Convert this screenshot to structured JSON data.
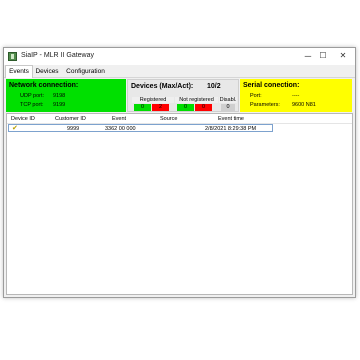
{
  "window": {
    "title": "SiaIP - MLR II Gateway",
    "controls": {
      "minimize": "─",
      "maximize": "☐",
      "close": "✕"
    }
  },
  "tabs": [
    {
      "label": "Events",
      "active": true
    },
    {
      "label": "Devices",
      "active": false
    },
    {
      "label": "Configuration",
      "active": false
    }
  ],
  "network": {
    "title": "Network connection:",
    "udp_label": "UDP port:",
    "udp_value": "9198",
    "tcp_label": "TCP port:",
    "tcp_value": "9199",
    "color": "#00e000"
  },
  "devices": {
    "title": "Devices (Max/Act):",
    "value": "10/2",
    "registered_label": "Registered",
    "not_registered_label": "Not registered",
    "disabled_label": "Disabl.",
    "registered_ok": "0",
    "registered_bad": "2",
    "not_registered_ok": "0",
    "not_registered_bad": "0",
    "disabled": "0"
  },
  "serial": {
    "title": "Serial conection:",
    "port_label": "Port:",
    "port_value": "----",
    "params_label": "Parameters:",
    "params_value": "9600 N81",
    "color": "#ffff00"
  },
  "events_table": {
    "columns": [
      "Device ID",
      "Customer ID",
      "Event",
      "Source",
      "Event time"
    ],
    "rows": [
      {
        "device_id": "",
        "customer_id": "9999",
        "event": "3362 00 000",
        "source": "",
        "event_time": "2/8/2021 8:29:38 PM"
      }
    ]
  }
}
